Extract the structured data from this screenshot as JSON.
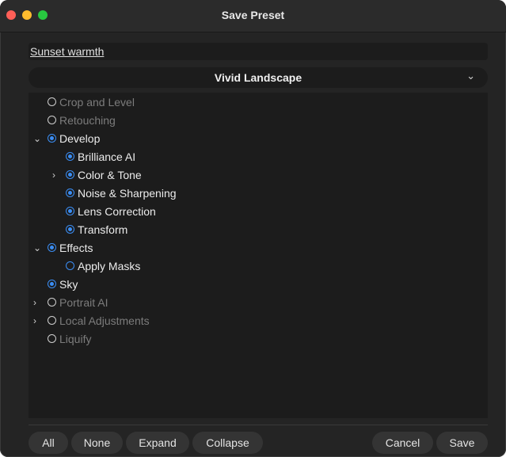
{
  "window": {
    "title": "Save Preset"
  },
  "name_field": {
    "value": "Sunset warmth"
  },
  "preset_select": {
    "value": "Vivid Landscape",
    "chevron": "chevron-down-icon"
  },
  "tree": {
    "items": [
      {
        "label": "Crop and Level",
        "state": "off",
        "enabled": false,
        "level": 0,
        "disclosure": "none"
      },
      {
        "label": "Retouching",
        "state": "off",
        "enabled": false,
        "level": 0,
        "disclosure": "none"
      },
      {
        "label": "Develop",
        "state": "on",
        "enabled": true,
        "level": 0,
        "disclosure": "expanded"
      },
      {
        "label": "Brilliance AI",
        "state": "on",
        "enabled": true,
        "level": 1,
        "disclosure": "none"
      },
      {
        "label": "Color & Tone",
        "state": "on",
        "enabled": true,
        "level": 1,
        "disclosure": "collapsed"
      },
      {
        "label": "Noise & Sharpening",
        "state": "on",
        "enabled": true,
        "level": 1,
        "disclosure": "none"
      },
      {
        "label": "Lens Correction",
        "state": "on",
        "enabled": true,
        "level": 1,
        "disclosure": "none"
      },
      {
        "label": "Transform",
        "state": "on",
        "enabled": true,
        "level": 1,
        "disclosure": "none"
      },
      {
        "label": "Effects",
        "state": "on",
        "enabled": true,
        "level": 0,
        "disclosure": "expanded"
      },
      {
        "label": "Apply Masks",
        "state": "off",
        "enabled": true,
        "level": 1,
        "disclosure": "none"
      },
      {
        "label": "Sky",
        "state": "on",
        "enabled": true,
        "level": 0,
        "disclosure": "none"
      },
      {
        "label": "Portrait AI",
        "state": "off",
        "enabled": false,
        "level": 0,
        "disclosure": "collapsed"
      },
      {
        "label": "Local Adjustments",
        "state": "off",
        "enabled": false,
        "level": 0,
        "disclosure": "collapsed"
      },
      {
        "label": "Liquify",
        "state": "off",
        "enabled": false,
        "level": 0,
        "disclosure": "none"
      }
    ]
  },
  "buttons": {
    "all": "All",
    "none": "None",
    "expand": "Expand",
    "collapse": "Collapse",
    "cancel": "Cancel",
    "save": "Save"
  },
  "colors": {
    "accent": "#3b8ef5",
    "window_bg": "#242424",
    "panel_bg": "#1c1c1c",
    "button_bg": "#343434"
  }
}
